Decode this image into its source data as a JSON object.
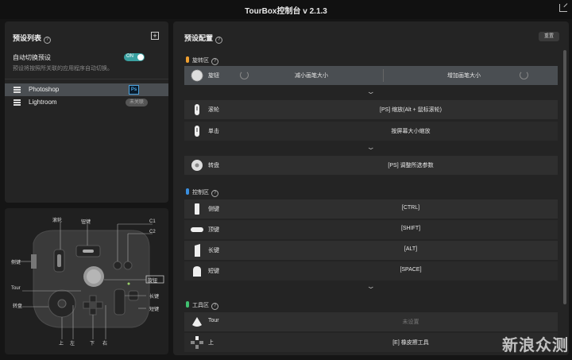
{
  "window": {
    "title": "TourBox控制台 v 2.1.3"
  },
  "presets": {
    "title": "预设列表",
    "auto_switch_label": "自动切换预设",
    "toggle_label": "ON",
    "auto_switch_desc": "预设将按照所关联的应用程序自动切换。",
    "items": [
      {
        "name": "Photoshop",
        "badge": "Ps",
        "active": true
      },
      {
        "name": "Lightroom",
        "badge": "未关联",
        "active": false
      }
    ]
  },
  "device": {
    "labels": {
      "scroll": "滚轮",
      "knob": "钮键",
      "c1": "C1",
      "c2": "C2",
      "side": "侧键",
      "tour": "Tour",
      "dial": "转盘",
      "knob_btn": "旋钮",
      "long": "长键",
      "short": "短键",
      "up": "上",
      "left": "左",
      "down": "下",
      "right": "右"
    }
  },
  "config": {
    "title": "预设配置",
    "reset_label": "重置",
    "sections": [
      {
        "name": "旋转区",
        "color": "#f0a030"
      },
      {
        "name": "控制区",
        "color": "#3a8fe0"
      },
      {
        "name": "工具区",
        "color": "#40c070"
      }
    ],
    "knob_row": {
      "label": "旋钮",
      "left": "减小画笔大小",
      "right": "增加画笔大小"
    },
    "rows": [
      {
        "label": "滚轮",
        "value": "[PS] 缩放(Alt + 鼠标滚轮)"
      },
      {
        "label": "单击",
        "value": "按屏幕大小缩放"
      },
      {
        "label": "转盘",
        "value": "[PS] 调整所选参数"
      },
      {
        "label": "侧键",
        "value": "[CTRL]"
      },
      {
        "label": "顶键",
        "value": "[SHIFT]"
      },
      {
        "label": "长键",
        "value": "[ALT]"
      },
      {
        "label": "短键",
        "value": "[SPACE]"
      },
      {
        "label": "Tour",
        "value": "未设置"
      },
      {
        "label": "上",
        "value": "[E] 橡皮擦工具"
      }
    ]
  },
  "watermark": "新浪众测"
}
